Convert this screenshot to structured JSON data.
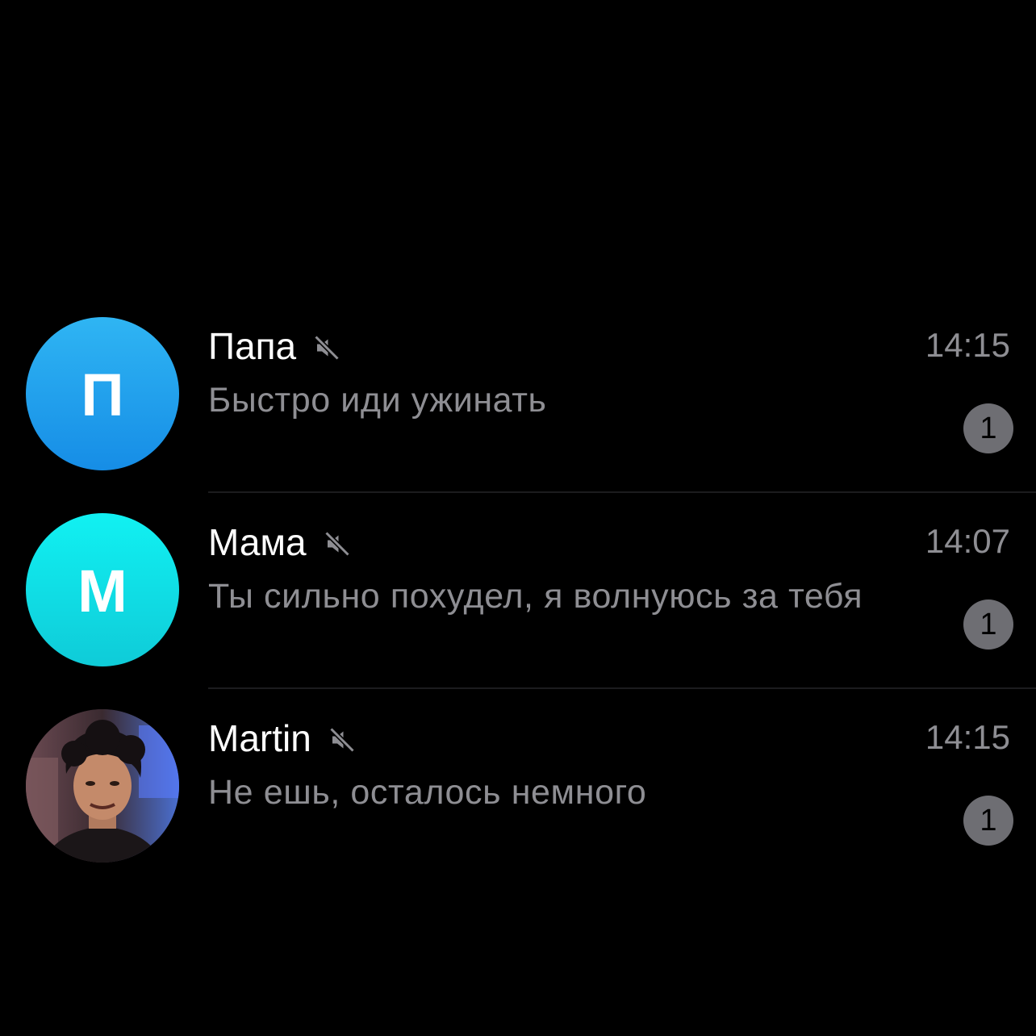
{
  "chats": [
    {
      "name": "Папа",
      "avatar_letter": "П",
      "muted": true,
      "time": "14:15",
      "preview": "Быстро иди ужинать",
      "unread": "1"
    },
    {
      "name": "Мама",
      "avatar_letter": "М",
      "muted": true,
      "time": "14:07",
      "preview": "Ты сильно похудел, я волнуюсь за тебя",
      "unread": "1"
    },
    {
      "name": "Martin",
      "avatar_letter": "",
      "muted": true,
      "time": "14:15",
      "preview": "Не ешь, осталось немного",
      "unread": "1"
    }
  ],
  "colors": {
    "background": "#000000",
    "avatar_blue": "#168de6",
    "avatar_cyan": "#0fcbd8",
    "secondary_text": "#8e8e93",
    "badge": "#6e6e73"
  },
  "icons": {
    "mute": "muted-speaker-icon"
  }
}
